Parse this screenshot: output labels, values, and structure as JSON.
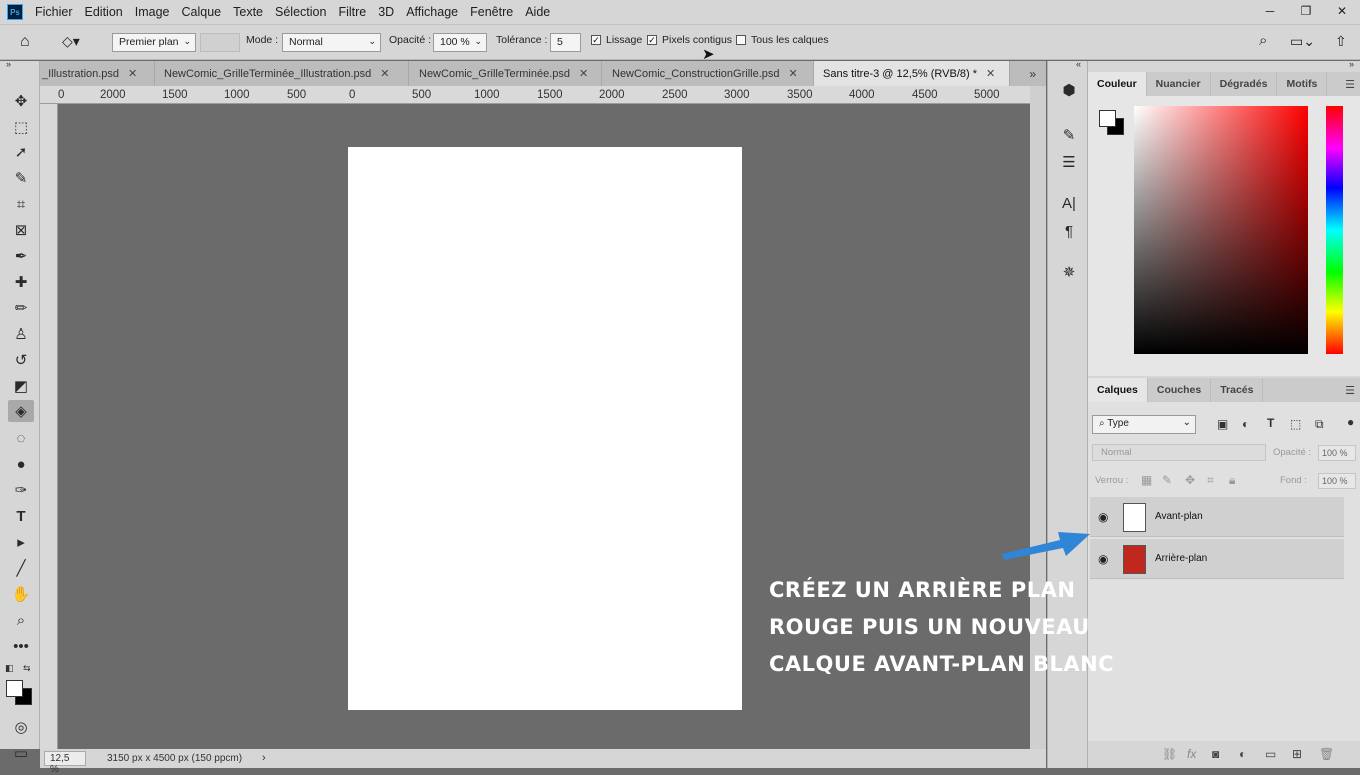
{
  "app": {
    "logo": "Ps"
  },
  "menu": [
    "Fichier",
    "Edition",
    "Image",
    "Calque",
    "Texte",
    "Sélection",
    "Filtre",
    "3D",
    "Affichage",
    "Fenêtre",
    "Aide"
  ],
  "window_controls": {
    "minimize": "─",
    "restore": "❐",
    "close": "✕"
  },
  "options": {
    "fill_source": "Premier plan",
    "mode_label": "Mode :",
    "mode_value": "Normal",
    "opacity_label": "Opacité :",
    "opacity_value": "100 %",
    "tolerance_label": "Tolérance :",
    "tolerance_value": "5",
    "smoothing_label": "Lissage",
    "smoothing_checked": true,
    "contiguous_label": "Pixels contigus",
    "contiguous_checked": true,
    "all_layers_label": "Tous les calques",
    "all_layers_checked": false
  },
  "tabs": [
    {
      "label": "_Illustration.psd",
      "active": false
    },
    {
      "label": "NewComic_GrilleTerminée_Illustration.psd",
      "active": false
    },
    {
      "label": "NewComic_GrilleTerminée.psd",
      "active": false
    },
    {
      "label": "NewComic_ConstructionGrille.psd",
      "active": false
    },
    {
      "label": "Sans titre-3 @ 12,5% (RVB/8) *",
      "active": true
    }
  ],
  "ruler": {
    "top": [
      "0",
      "2000",
      "1500",
      "1000",
      "500",
      "0",
      "500",
      "1000",
      "1500",
      "2000",
      "2500",
      "3000",
      "3500",
      "4000",
      "4500",
      "5000"
    ]
  },
  "status": {
    "zoom": "12,5 %",
    "doc_info": "3150 px x 4500 px (150 ppcm)"
  },
  "color_panel": {
    "tabs": [
      "Couleur",
      "Nuancier",
      "Dégradés",
      "Motifs"
    ],
    "foreground": "#ffffff",
    "background": "#000000"
  },
  "layers_panel": {
    "tabs": [
      "Calques",
      "Couches",
      "Tracés"
    ],
    "filter_value": "Type",
    "blend_mode": "Normal",
    "opacity_label": "Opacité :",
    "opacity_value": "100 %",
    "lock_label": "Verrou :",
    "fill_label": "Fond :",
    "fill_value": "100 %",
    "layers": [
      {
        "name": "Avant-plan",
        "color": "#ffffff",
        "visible": true,
        "selected": false
      },
      {
        "name": "Arrière-plan",
        "color": "#c1281d",
        "visible": true,
        "selected": false
      }
    ]
  },
  "annotation": {
    "lines": [
      "CRÉEZ UN ARRIÈRE PLAN",
      "ROUGE PUIS UN NOUVEAU",
      "CALQUE AVANT-PLAN BLANC"
    ],
    "arrow_color": "#2f86d6"
  }
}
